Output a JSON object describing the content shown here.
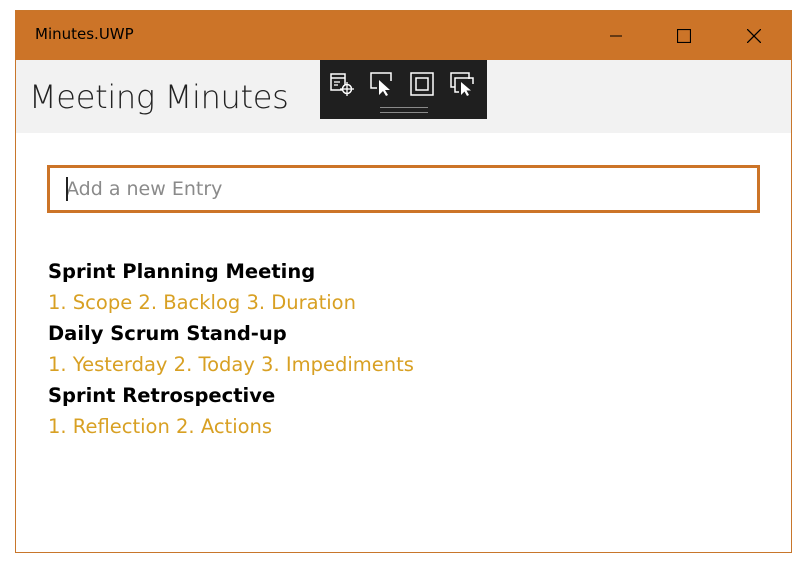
{
  "window": {
    "title": "Minutes.UWP",
    "accent_color": "#cc7428"
  },
  "header": {
    "title": "Meeting Minutes"
  },
  "debug_toolbar": {
    "icons": [
      "select-element-icon",
      "display-layout-adorners-icon",
      "track-focus-icon",
      "live-visual-tree-icon"
    ]
  },
  "entry_input": {
    "placeholder": "Add a new Entry",
    "value": ""
  },
  "minutes": [
    {
      "title": "Sprint Planning Meeting",
      "agenda": "1. Scope 2. Backlog 3. Duration"
    },
    {
      "title": "Daily Scrum Stand-up",
      "agenda": "1. Yesterday 2. Today 3. Impediments"
    },
    {
      "title": "Sprint Retrospective",
      "agenda": "1. Reflection 2. Actions"
    }
  ],
  "colors": {
    "title_text": "#000000",
    "agenda_text": "#d8a023"
  }
}
